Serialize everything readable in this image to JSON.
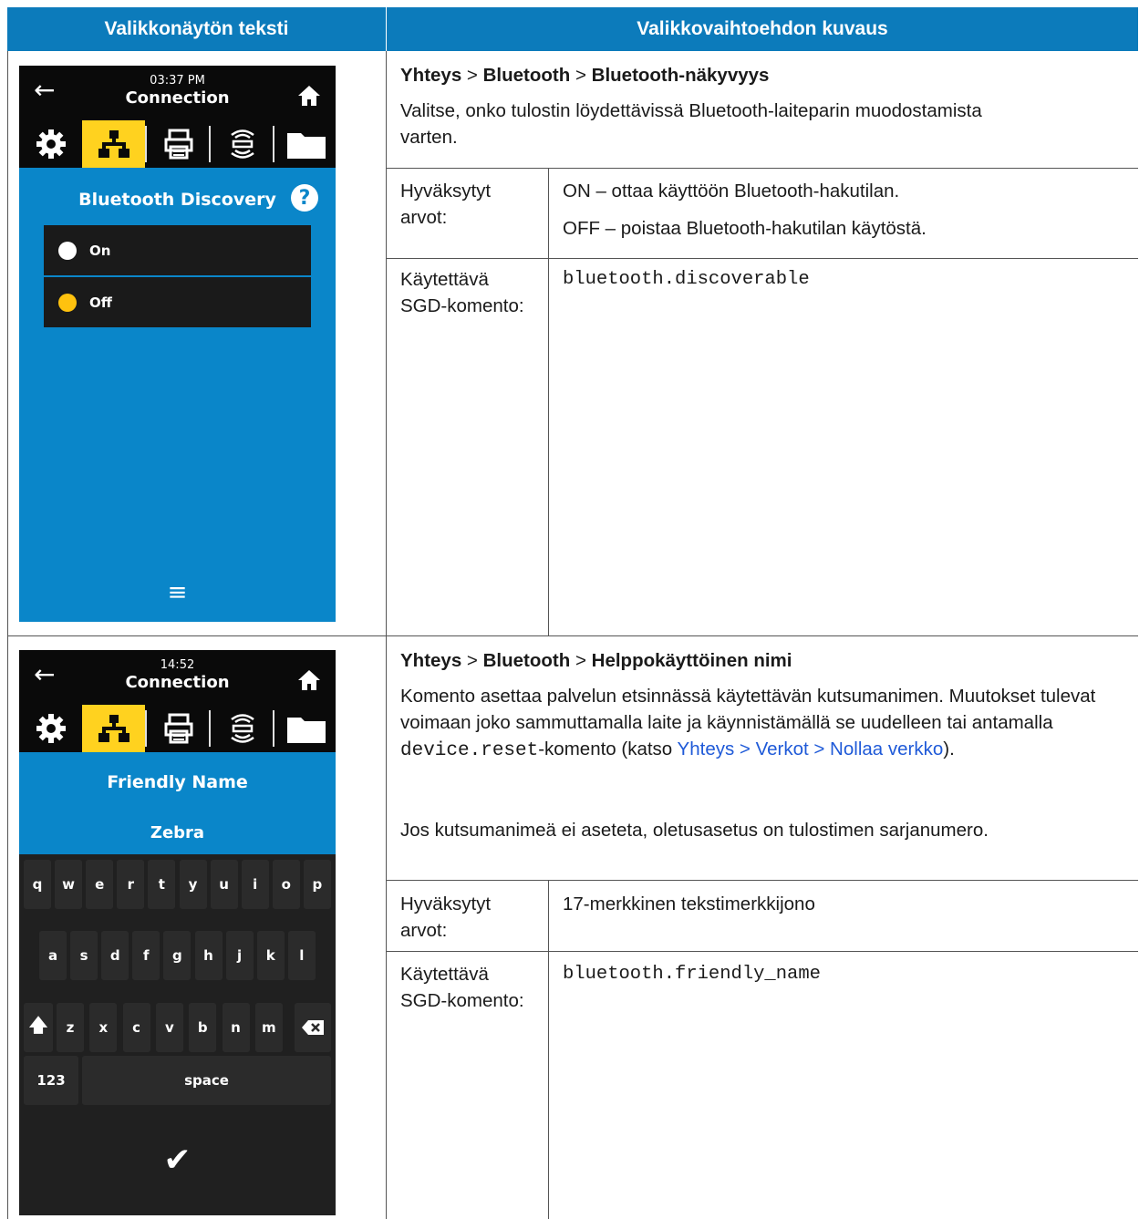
{
  "header": {
    "col1": "Valikkonäytön teksti",
    "col2": "Valikkovaihtoehdon kuvaus"
  },
  "rows": [
    {
      "screen": {
        "time": "03:37 PM",
        "title": "Connection",
        "heading": "Bluetooth Discovery",
        "options": [
          "On",
          "Off"
        ],
        "selected": "Off"
      },
      "crumb": [
        "Yhteys",
        "Bluetooth",
        "Bluetooth-näkyvyys"
      ],
      "description": "Valitse, onko tulostin löydettävissä Bluetooth-laiteparin muodostamista varten.",
      "accepted_label": "Hyväksytyt arvot:",
      "accepted_values": [
        "ON – ottaa käyttöön Bluetooth-hakutilan.",
        "OFF – poistaa Bluetooth-hakutilan käytöstä."
      ],
      "command_label": "Käytettävä SGD-komento:",
      "command": "bluetooth.discoverable"
    },
    {
      "screen": {
        "time": "14:52",
        "title": "Connection",
        "heading": "Friendly Name",
        "value": "Zebra",
        "keys_row1": [
          "q",
          "w",
          "e",
          "r",
          "t",
          "y",
          "u",
          "i",
          "o",
          "p"
        ],
        "keys_row2": [
          "a",
          "s",
          "d",
          "f",
          "g",
          "h",
          "j",
          "k",
          "l"
        ],
        "keys_row3": [
          "z",
          "x",
          "c",
          "v",
          "b",
          "n",
          "m"
        ],
        "key_123": "123",
        "key_space": "space"
      },
      "crumb": [
        "Yhteys",
        "Bluetooth",
        "Helppokäyttöinen nimi"
      ],
      "desc_part1": "Komento asettaa palvelun etsinnässä käytettävän kutsumanimen. Muutokset tulevat voimaan joko sammuttamalla laite ja käynnistämällä se uudelleen tai antamalla ",
      "desc_code": "device.reset",
      "desc_part2": "-komento (katso ",
      "desc_link": "Yhteys > Verkot > Nollaa verkko",
      "desc_part3": ").",
      "description2": "Jos kutsumanimeä ei aseteta, oletusasetus on tulostimen sarjanumero.",
      "accepted_label": "Hyväksytyt arvot:",
      "accepted_values": [
        "17-merkkinen tekstimerkkijono"
      ],
      "command_label": "Käytettävä SGD-komento:",
      "command": "bluetooth.friendly_name"
    }
  ],
  "colors": {
    "header": "#0c7bbb",
    "screen_blue": "#0a86c9",
    "tab_active": "#ffd21f",
    "link": "#1f5ad8"
  }
}
